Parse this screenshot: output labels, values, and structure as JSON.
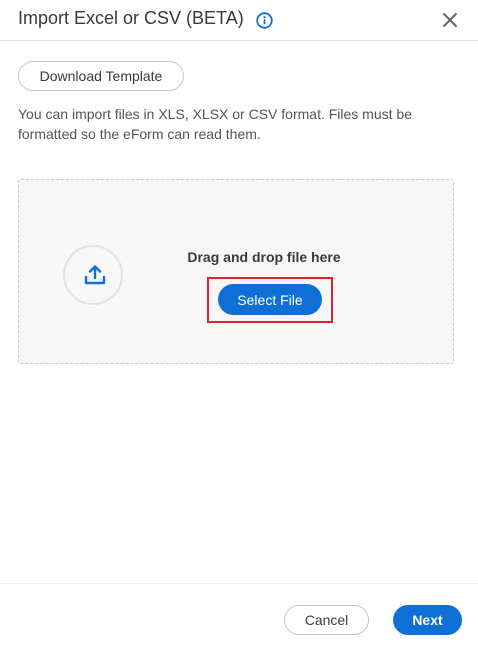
{
  "dialog": {
    "title": "Import Excel or CSV (BETA)",
    "info_icon": "info-icon",
    "close_icon": "close-icon"
  },
  "download_template": {
    "label": "Download Template"
  },
  "description": "You can import files in XLS, XLSX or CSV format. Files must be formatted so the eForm can read them.",
  "dropzone": {
    "upload_icon": "upload-icon",
    "drag_text": "Drag and drop file here",
    "select_button": "Select File"
  },
  "footer": {
    "cancel_label": "Cancel",
    "next_label": "Next"
  },
  "colors": {
    "primary": "#0e6fd6",
    "highlight_border": "#d9252b",
    "dropzone_bg": "#f7f7f7"
  }
}
